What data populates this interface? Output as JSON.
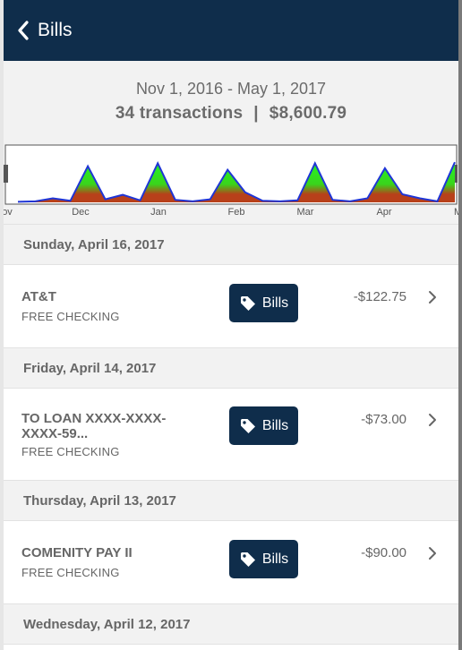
{
  "header": {
    "back_label": "Bills"
  },
  "summary": {
    "date_range": "Nov 1, 2016 - May 1, 2017",
    "transactions": "34 transactions",
    "separator": "|",
    "total": "$8,600.79"
  },
  "chart_data": {
    "type": "area",
    "x_tick_labels": [
      "ov",
      "Dec",
      "Jan",
      "Feb",
      "Mar",
      "Apr",
      "Ma"
    ],
    "colors": {
      "line": "#1f35d6",
      "top_fill": "#23f523",
      "bottom_fill": "#b8401a"
    }
  },
  "groups": [
    {
      "date": "Sunday, April 16, 2017",
      "transactions": [
        {
          "name": "AT&T",
          "account": "FREE CHECKING",
          "tag": "Bills",
          "amount": "-$122.75"
        }
      ]
    },
    {
      "date": "Friday, April 14, 2017",
      "transactions": [
        {
          "name": "TO LOAN XXXX-XXXX-XXXX-59...",
          "account": "FREE CHECKING",
          "tag": "Bills",
          "amount": "-$73.00"
        }
      ]
    },
    {
      "date": "Thursday, April 13, 2017",
      "transactions": [
        {
          "name": "COMENITY PAY II",
          "account": "FREE CHECKING",
          "tag": "Bills",
          "amount": "-$90.00"
        }
      ]
    },
    {
      "date": "Wednesday, April 12, 2017",
      "transactions": []
    }
  ],
  "colors": {
    "navbar": "#0f2d4b",
    "tag_button": "#0f2d4b",
    "section_bg": "#f2f2f2"
  },
  "icons": {
    "back": "chevron-left-icon",
    "tag": "tag-icon",
    "row_chevron": "chevron-right-icon"
  }
}
